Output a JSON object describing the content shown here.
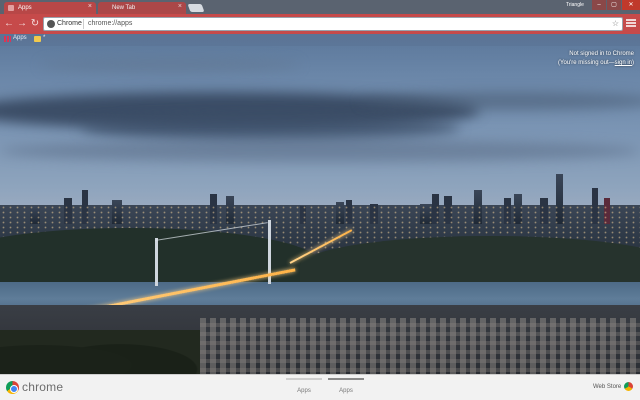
{
  "window": {
    "profile_name": "Triangle",
    "buttons": {
      "minimize": "–",
      "maximize": "▢",
      "close": "✕"
    }
  },
  "tabs": [
    {
      "label": "Apps",
      "active": true
    },
    {
      "label": "New Tab",
      "active": false
    }
  ],
  "toolbar": {
    "back_icon": "←",
    "forward_icon": "→",
    "reload_icon": "↻",
    "chip_label": "Chrome",
    "url": "chrome://apps",
    "star_icon": "☆"
  },
  "bookmarks": [
    {
      "label": "Apps",
      "icon": "apps-grid-icon"
    },
    {
      "label": "*",
      "icon": "folder-icon"
    }
  ],
  "signin": {
    "line1": "Not signed in to Chrome",
    "line2_prefix": "(You're missing out—",
    "line2_link": "sign in",
    "line2_suffix": ")"
  },
  "bottom": {
    "brand": "chrome",
    "pages": [
      {
        "label": "Apps",
        "active": false
      },
      {
        "label": "Apps",
        "active": true
      }
    ],
    "web_store_label": "Web Store"
  },
  "colors": {
    "accent_tab": "#b84747",
    "toolbar": "#c64a4a",
    "bottom_bar": "#f2f2f2"
  }
}
